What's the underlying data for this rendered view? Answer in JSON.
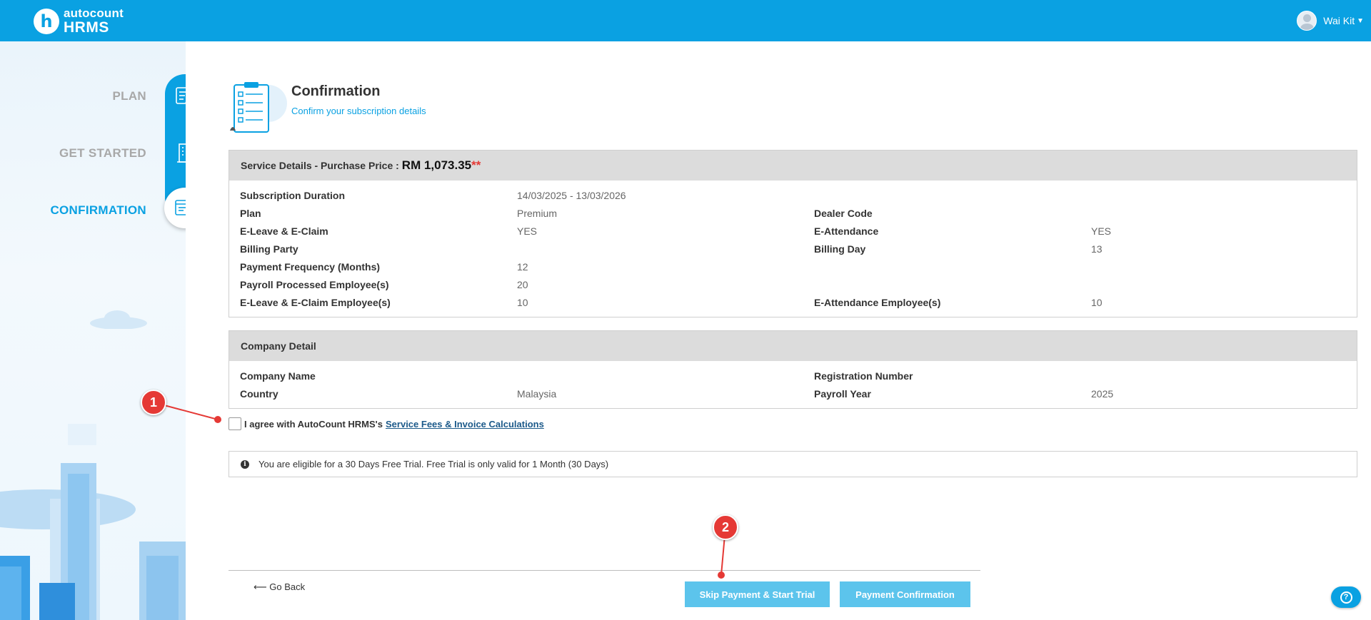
{
  "app": {
    "logo_top": "autocount",
    "logo_bottom": "HRMS",
    "logo_mark": "h"
  },
  "user": {
    "name": "Wai Kit"
  },
  "steps": [
    {
      "label": "PLAN",
      "icon": "edit-document-icon",
      "state": "done"
    },
    {
      "label": "GET STARTED",
      "icon": "building-icon",
      "state": "done"
    },
    {
      "label": "CONFIRMATION",
      "icon": "confirm-document-icon",
      "state": "active"
    }
  ],
  "header": {
    "title": "Confirmation",
    "subtitle": "Confirm your subscription details"
  },
  "service": {
    "heading": "Service Details - Purchase Price :",
    "price": "RM 1,073.35",
    "price_mark": "**",
    "rows": [
      {
        "l1": "Subscription Duration",
        "v1": "14/03/2025 - 13/03/2026",
        "l2": "",
        "v2": ""
      },
      {
        "l1": "Plan",
        "v1": "Premium",
        "l2": "Dealer Code",
        "v2": ""
      },
      {
        "l1": "E-Leave & E-Claim",
        "v1": "YES",
        "l2": "E-Attendance",
        "v2": "YES"
      },
      {
        "l1": "Billing Party",
        "v1": "",
        "l2": "Billing Day",
        "v2": "13"
      },
      {
        "l1": "Payment Frequency (Months)",
        "v1": "12",
        "l2": "",
        "v2": ""
      },
      {
        "l1": "Payroll Processed Employee(s)",
        "v1": "20",
        "l2": "",
        "v2": ""
      },
      {
        "l1": "E-Leave & E-Claim Employee(s)",
        "v1": "10",
        "l2": "E-Attendance Employee(s)",
        "v2": "10"
      }
    ]
  },
  "company": {
    "heading": "Company Detail",
    "rows": [
      {
        "l1": "Company Name",
        "v1": "",
        "l2": "Registration Number",
        "v2": ""
      },
      {
        "l1": "Country",
        "v1": "Malaysia",
        "l2": "Payroll Year",
        "v2": "2025"
      }
    ]
  },
  "agreement": {
    "text": "I agree with AutoCount HRMS's",
    "link": "Service Fees & Invoice Calculations",
    "checked": false
  },
  "info": {
    "icon": "info-icon",
    "text": "You are eligible for a 30 Days Free Trial. Free Trial is only valid for 1 Month (30 Days)"
  },
  "actions": {
    "back": "⟵ Go Back",
    "skip": "Skip Payment & Start Trial",
    "pay": "Payment Confirmation"
  },
  "annotations": {
    "marker1": "1",
    "marker2": "2"
  },
  "colors": {
    "brand": "#0aa1e2",
    "button": "#5cc4ec",
    "marker": "#e53935"
  }
}
